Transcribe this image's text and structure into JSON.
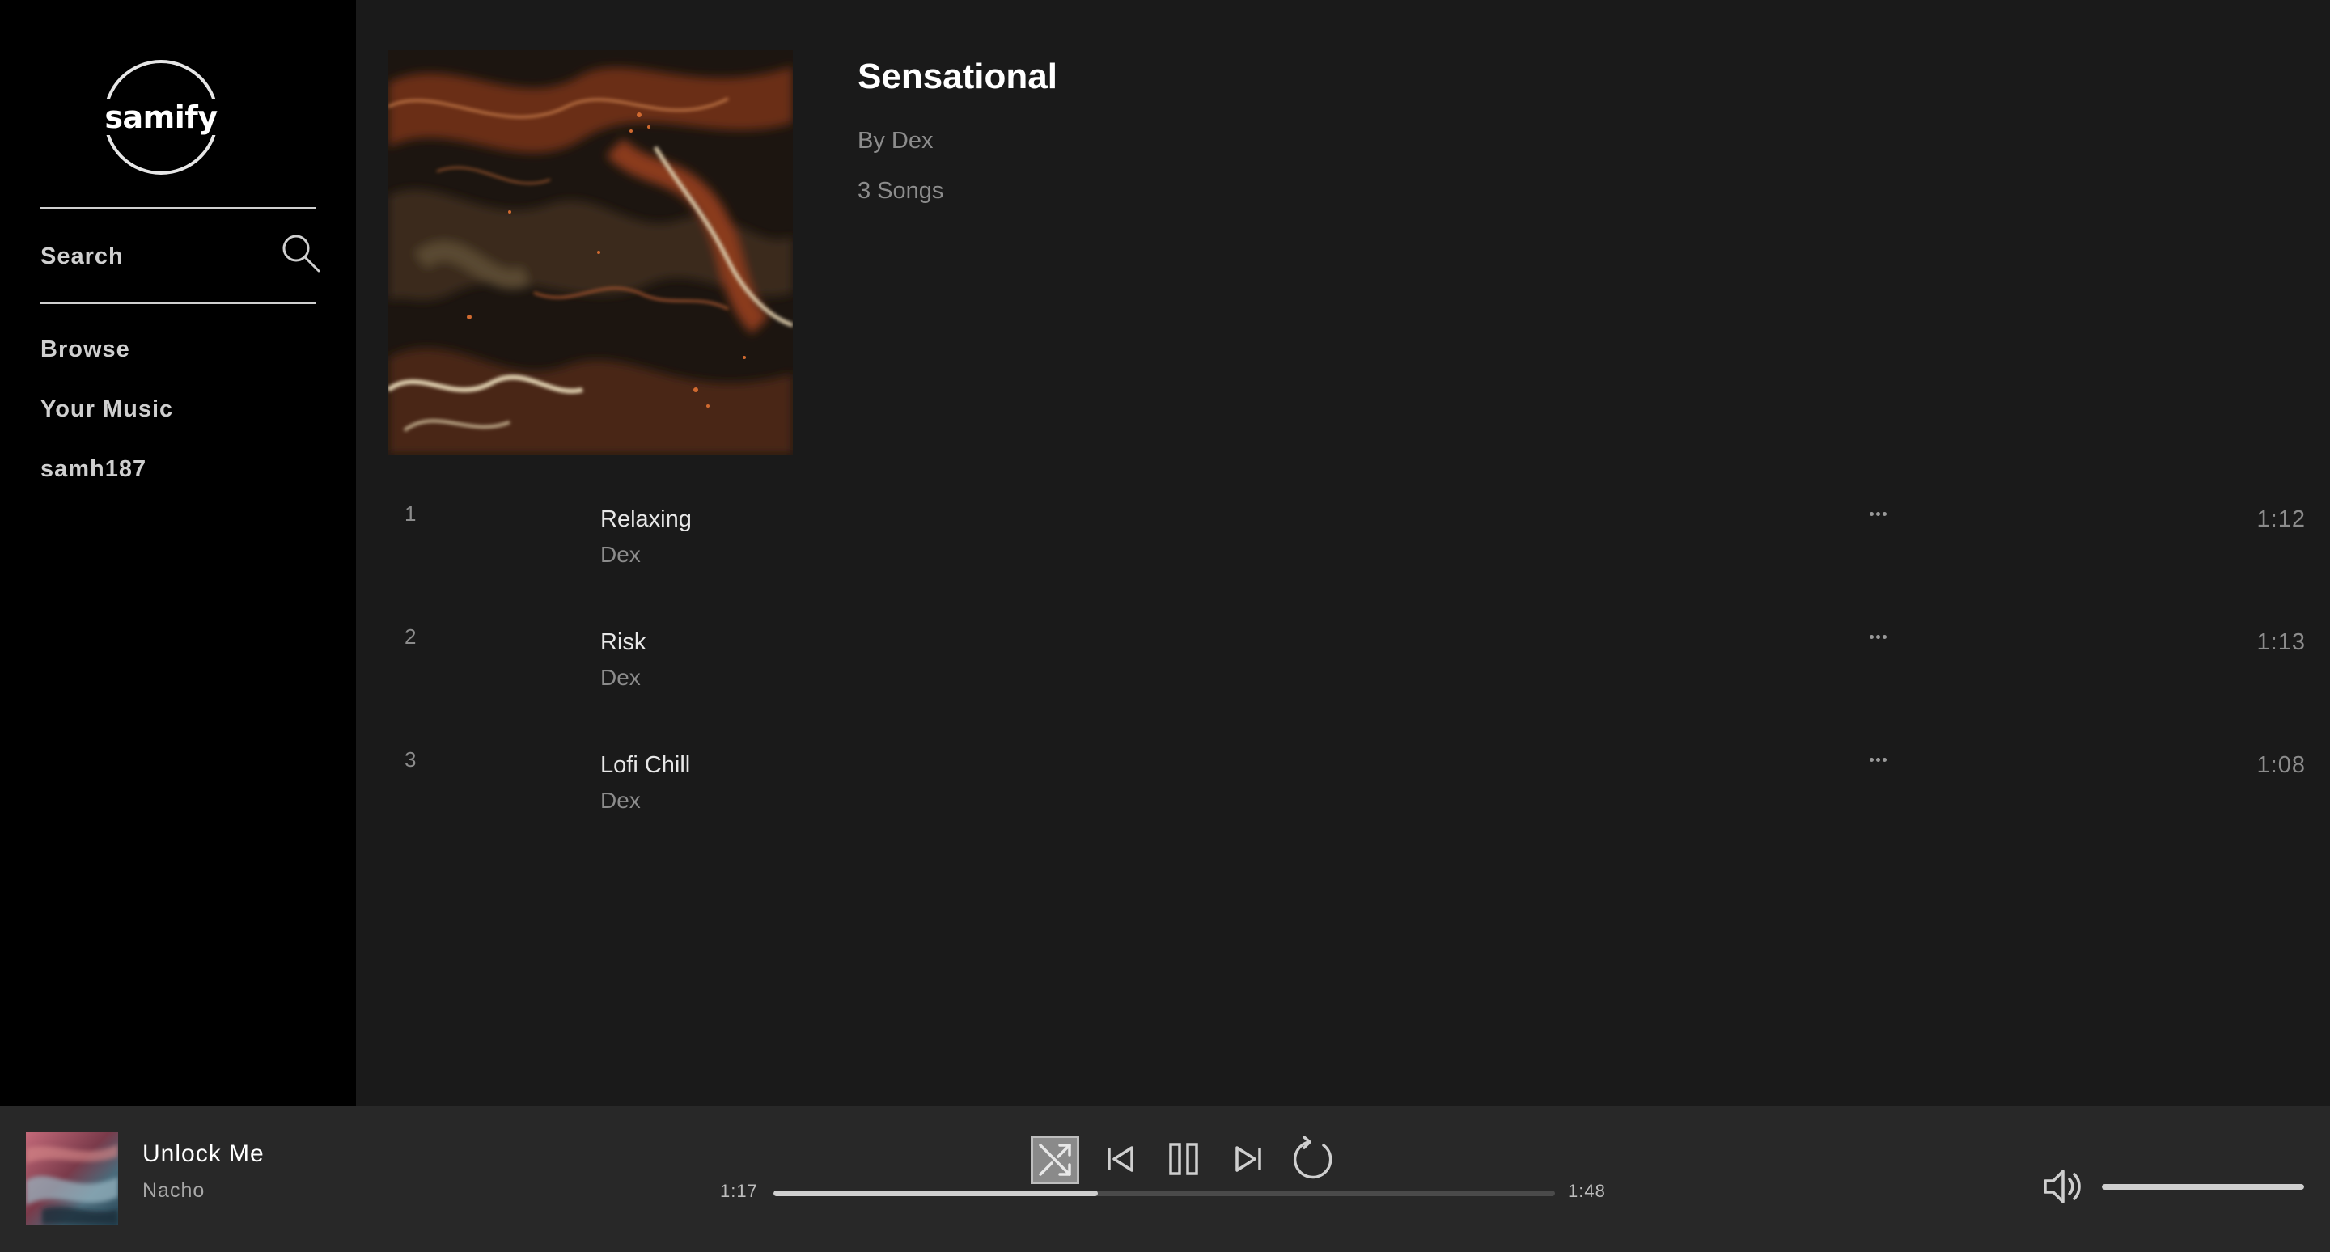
{
  "sidebar": {
    "logo_text": "samify",
    "search_label": "Search",
    "nav": [
      {
        "label": "Browse"
      },
      {
        "label": "Your Music"
      },
      {
        "label": "samh187"
      }
    ]
  },
  "album": {
    "title": "Sensational",
    "artist": "By Dex",
    "song_count": "3 Songs",
    "cover_icon": "album-cover-art"
  },
  "tracks": [
    {
      "number": "1",
      "title": "Relaxing",
      "artist": "Dex",
      "duration": "1:12"
    },
    {
      "number": "2",
      "title": "Risk",
      "artist": "Dex",
      "duration": "1:13"
    },
    {
      "number": "3",
      "title": "Lofi Chill",
      "artist": "Dex",
      "duration": "1:08"
    }
  ],
  "player": {
    "now_playing": {
      "title": "Unlock Me",
      "artist": "Nacho"
    },
    "time_current": "1:17",
    "time_total": "1:48",
    "progress_fraction": 0.415,
    "volume_fraction": 1.0,
    "shuffle_active": true,
    "icons": [
      "shuffle-icon",
      "previous-icon",
      "pause-icon",
      "next-icon",
      "repeat-icon",
      "volume-icon"
    ]
  },
  "colors": {
    "sidebar_bg": "#000000",
    "main_bg": "#1a1a1a",
    "player_bg": "#282828",
    "muted_text": "#8c8c8c"
  }
}
